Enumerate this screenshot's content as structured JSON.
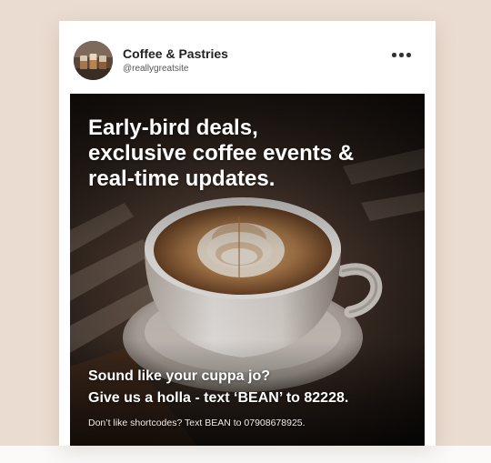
{
  "post": {
    "account_name": "Coffee & Pastries",
    "account_handle": "@reallygreatsite",
    "more_icon": "more-horizontal-icon",
    "headline_lines": [
      "Early-bird deals,",
      "exclusive coffee events &",
      "real-time updates."
    ],
    "cta_lines": [
      "Sound like your cuppa jo?",
      "Give us a holla - text ‘BEAN’ to 82228."
    ],
    "footnote": "Don’t like shortcodes? Text BEAN to 07908678925."
  },
  "colors": {
    "page_background": "#ebdcd1",
    "card_background": "#ffffff",
    "text_on_image": "#ffffff"
  }
}
